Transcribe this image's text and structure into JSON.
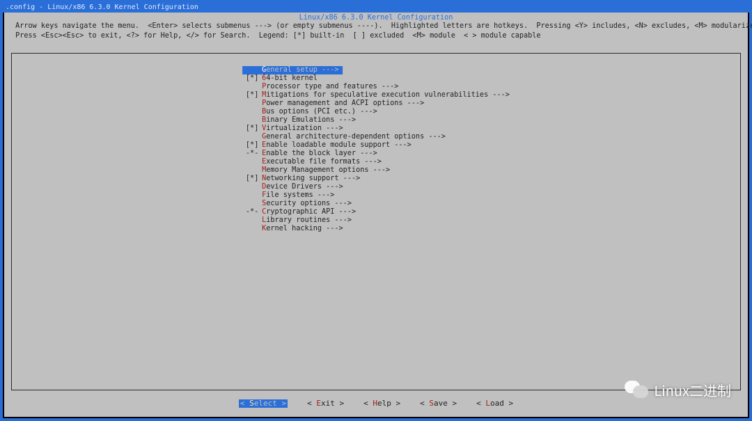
{
  "window_title": ".config - Linux/x86 6.3.0 Kernel Configuration",
  "dialog_title": "Linux/x86 6.3.0 Kernel Configuration",
  "help_line1": " Arrow keys navigate the menu.  <Enter> selects submenus ---> (or empty submenus ----).  Highlighted letters are hotkeys.  Pressing <Y> includes, <N> excludes, <M> modularizes features.",
  "help_line2": " Press <Esc><Esc> to exit, <?> for Help, </> for Search.  Legend: [*] built-in  [ ] excluded  <M> module  < > module capable",
  "menu": [
    {
      "bracket": "   ",
      "hot": "G",
      "rest": "eneral setup",
      "arrow": "  --->",
      "selected": true
    },
    {
      "bracket": "[*]",
      "hot": "6",
      "rest": "4-bit kernel",
      "arrow": "",
      "selected": false
    },
    {
      "bracket": "   ",
      "hot": "P",
      "rest": "rocessor type and features",
      "arrow": "  --->",
      "selected": false
    },
    {
      "bracket": "[*]",
      "hot": "M",
      "rest": "itigations for speculative execution vulnerabilities",
      "arrow": "  --->",
      "selected": false
    },
    {
      "bracket": "   ",
      "hot": "P",
      "rest": "ower management and ACPI options",
      "arrow": "  --->",
      "selected": false
    },
    {
      "bracket": "   ",
      "hot": "B",
      "rest": "us options (PCI etc.)",
      "arrow": "  --->",
      "selected": false
    },
    {
      "bracket": "   ",
      "hot": "B",
      "rest": "inary Emulations",
      "arrow": "  --->",
      "selected": false
    },
    {
      "bracket": "[*]",
      "hot": "V",
      "rest": "irtualization",
      "arrow": "  --->",
      "selected": false
    },
    {
      "bracket": "   ",
      "hot": "G",
      "rest": "eneral architecture-dependent options",
      "arrow": "  --->",
      "selected": false
    },
    {
      "bracket": "[*]",
      "hot": "E",
      "rest": "nable loadable module support",
      "arrow": "  --->",
      "selected": false
    },
    {
      "bracket": "-*-",
      "hot": "E",
      "rest": "nable the block layer",
      "arrow": "  --->",
      "selected": false
    },
    {
      "bracket": "   ",
      "hot": "E",
      "rest": "xecutable file formats",
      "arrow": "  --->",
      "selected": false
    },
    {
      "bracket": "   ",
      "hot": "M",
      "rest": "emory Management options",
      "arrow": "  --->",
      "selected": false
    },
    {
      "bracket": "[*]",
      "hot": "N",
      "rest": "etworking support",
      "arrow": "  --->",
      "selected": false
    },
    {
      "bracket": "   ",
      "hot": "D",
      "rest": "evice Drivers",
      "arrow": "  --->",
      "selected": false
    },
    {
      "bracket": "   ",
      "hot": "F",
      "rest": "ile systems",
      "arrow": "  --->",
      "selected": false
    },
    {
      "bracket": "   ",
      "hot": "S",
      "rest": "ecurity options",
      "arrow": "  --->",
      "selected": false
    },
    {
      "bracket": "-*-",
      "hot": "C",
      "rest": "ryptographic API",
      "arrow": "  --->",
      "selected": false
    },
    {
      "bracket": "   ",
      "hot": "L",
      "rest": "ibrary routines",
      "arrow": "  --->",
      "selected": false
    },
    {
      "bracket": "   ",
      "hot": "K",
      "rest": "ernel hacking",
      "arrow": "  --->",
      "selected": false
    }
  ],
  "buttons": [
    {
      "hot": "S",
      "rest": "elect",
      "selected": true
    },
    {
      "hot": "E",
      "rest": "xit",
      "selected": false
    },
    {
      "hot": "H",
      "rest": "elp",
      "selected": false
    },
    {
      "hot": "S",
      "rest": "ave",
      "selected": false
    },
    {
      "hot": "L",
      "rest": "oad",
      "selected": false
    }
  ],
  "watermark_text": "Linux二进制"
}
